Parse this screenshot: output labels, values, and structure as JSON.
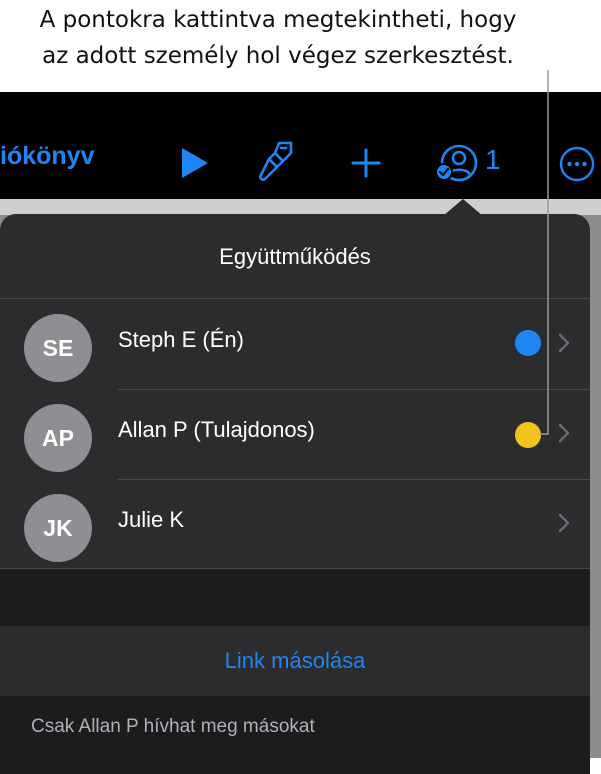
{
  "callout": {
    "line1": "A pontokra kattintva megtekintheti, hogy",
    "line2": "az adott személy hol végez szerkesztést."
  },
  "toolbar": {
    "title_partial": "iókönyv",
    "icons": [
      "play-icon",
      "paintbrush-icon",
      "plus-icon",
      "collaborate-icon",
      "more-icon"
    ],
    "collaborator_count": "1",
    "accent_color": "#1e86f4"
  },
  "popover": {
    "title": "Együttműködés",
    "participants": [
      {
        "initials": "SE",
        "name": "Steph E (Én)",
        "dot_color": "#1e86f4"
      },
      {
        "initials": "AP",
        "name": "Allan P (Tulajdonos)",
        "dot_color": "#f0c41b"
      },
      {
        "initials": "JK",
        "name": "Julie K",
        "dot_color": ""
      }
    ],
    "link_label": "Link másolása",
    "footer_note": "Csak Allan P hívhat meg másokat"
  }
}
